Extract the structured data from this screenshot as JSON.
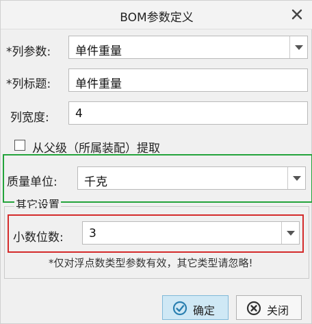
{
  "dialog": {
    "title": "BOM参数定义"
  },
  "form": {
    "column_param_label": "*列参数:",
    "column_param_value": "单件重量",
    "column_title_label": "*列标题:",
    "column_title_value": "单件重量",
    "column_width_label": "列宽度:",
    "column_width_value": "4",
    "inherit_checkbox_label": "从父级（所属装配）提取",
    "inherit_checked": false,
    "mass_unit_label": "质量单位:",
    "mass_unit_value": "千克"
  },
  "other_settings": {
    "legend": "其它设置",
    "decimal_label": "小数位数:",
    "decimal_value": "3",
    "note": "*仅对浮点数类型参数有效，其它类型请忽略!"
  },
  "buttons": {
    "ok_label": "确定",
    "close_label": "关闭"
  },
  "icons": {
    "close": "close-icon",
    "dropdown": "chevron-down-icon",
    "ok": "check-circle-icon",
    "cancel": "x-circle-icon"
  },
  "colors": {
    "highlight_green": "#22a33a",
    "highlight_red": "#d42a2a",
    "primary_button": "#cfe8f5"
  }
}
